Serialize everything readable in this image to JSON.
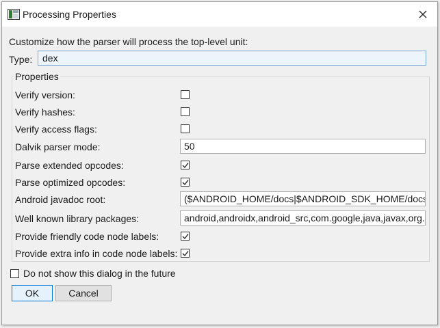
{
  "window": {
    "title": "Processing Properties"
  },
  "description": "Customize how the parser will process the top-level unit:",
  "type_field": {
    "label": "Type:",
    "value": "dex"
  },
  "properties": {
    "title": "Properties",
    "rows": [
      {
        "label": "Verify version:",
        "kind": "checkbox",
        "checked": false
      },
      {
        "label": "Verify hashes:",
        "kind": "checkbox",
        "checked": false
      },
      {
        "label": "Verify access flags:",
        "kind": "checkbox",
        "checked": false
      },
      {
        "label": "Dalvik parser mode:",
        "kind": "text",
        "value": "50"
      },
      {
        "label": "Parse extended opcodes:",
        "kind": "checkbox",
        "checked": true
      },
      {
        "label": "Parse optimized opcodes:",
        "kind": "checkbox",
        "checked": true
      },
      {
        "label": "Android javadoc root:",
        "kind": "text",
        "value": "($ANDROID_HOME/docs|$ANDROID_SDK_HOME/docs|$ANDROID_SDK_ROOT/docs)"
      },
      {
        "label": "Well known library packages:",
        "kind": "text",
        "value": "android,androidx,android_src,com.google,java,javax,org.apache"
      },
      {
        "label": "Provide friendly code node labels:",
        "kind": "checkbox",
        "checked": true
      },
      {
        "label": "Provide extra info in code node labels:",
        "kind": "checkbox",
        "checked": true
      }
    ]
  },
  "footer": {
    "dont_show_label": "Do not show this dialog in the future",
    "dont_show_checked": false,
    "ok_label": "OK",
    "cancel_label": "Cancel"
  },
  "colors": {
    "focus_border": "#0078d7",
    "type_field_bg": "#eef4fb"
  }
}
